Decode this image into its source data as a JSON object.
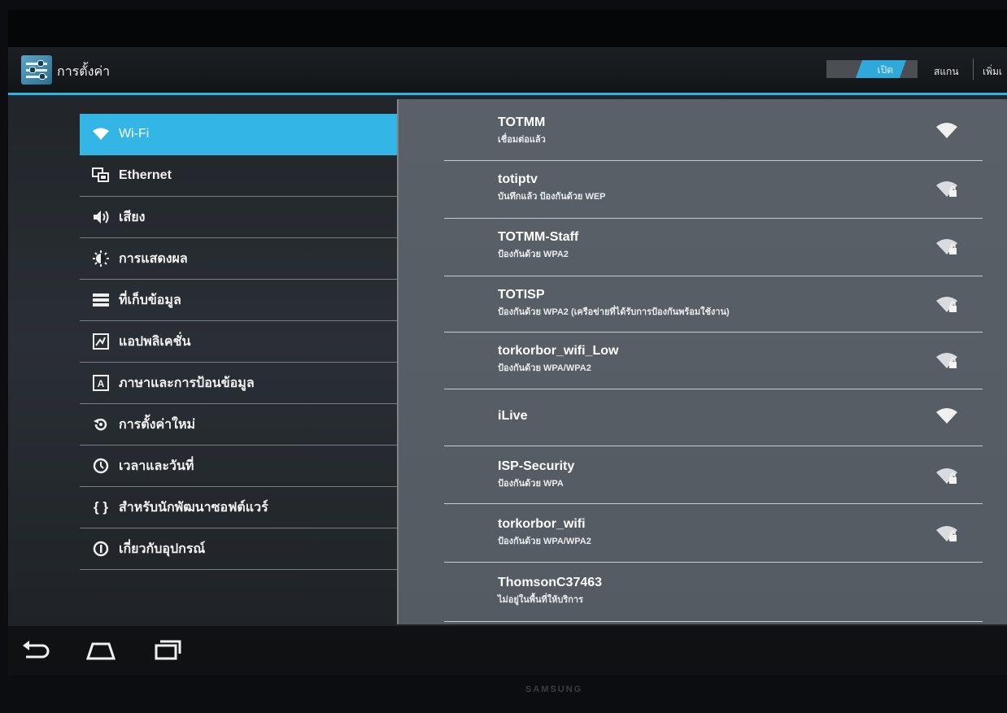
{
  "action_bar": {
    "title": "การตั้งค่า",
    "wifi_toggle": "เปิด",
    "scan": "สแกน",
    "add": "เพิ่มเ"
  },
  "sidebar": {
    "items": [
      {
        "label": "Wi-Fi",
        "icon": "wifi-icon",
        "active": true
      },
      {
        "label": "Ethernet",
        "icon": "ethernet-icon"
      },
      {
        "label": "เสียง",
        "icon": "speaker-icon"
      },
      {
        "label": "การแสดงผล",
        "icon": "display-icon"
      },
      {
        "label": "ที่เก็บข้อมูล",
        "icon": "storage-icon"
      },
      {
        "label": "แอปพลิเคชั่น",
        "icon": "apps-icon"
      },
      {
        "label": "ภาษาและการป้อนข้อมูล",
        "icon": "language-icon"
      },
      {
        "label": "การตั้งค่าใหม่",
        "icon": "reset-icon"
      },
      {
        "label": "เวลาและวันที่",
        "icon": "clock-icon"
      },
      {
        "label": "สำหรับนักพัฒนาซอฟต์แวร์",
        "icon": "developer-icon"
      },
      {
        "label": "เกี่ยวกับอุปกรณ์",
        "icon": "info-icon"
      }
    ]
  },
  "networks": [
    {
      "name": "TOTMM",
      "status": "เชื่อมต่อแล้ว",
      "secured": false,
      "signal": "wifi-signal-icon"
    },
    {
      "name": "totiptv",
      "status": "บันทึกแล้ว ป้องกันด้วย WEP",
      "secured": true,
      "signal": "wifi-lock-icon"
    },
    {
      "name": "TOTMM-Staff",
      "status": "ป้องกันด้วย WPA2",
      "secured": true,
      "signal": "wifi-lock-icon"
    },
    {
      "name": "TOTISP",
      "status": "ป้องกันด้วย WPA2 (เครือข่ายที่ได้รับการป้องกันพร้อมใช้งาน)",
      "secured": true,
      "signal": "wifi-lock-icon"
    },
    {
      "name": "torkorbor_wifi_Low",
      "status": "ป้องกันด้วย WPA/WPA2",
      "secured": true,
      "signal": "wifi-lock-icon"
    },
    {
      "name": "iLive",
      "status": "",
      "secured": false,
      "signal": "wifi-signal-icon"
    },
    {
      "name": "ISP-Security",
      "status": "ป้องกันด้วย WPA",
      "secured": true,
      "signal": "wifi-lock-icon"
    },
    {
      "name": "torkorbor_wifi",
      "status": "ป้องกันด้วย WPA/WPA2",
      "secured": true,
      "signal": "wifi-lock-icon"
    },
    {
      "name": "ThomsonC37463",
      "status": "ไม่อยู่ในพื้นที่ให้บริการ",
      "secured": true,
      "signal": ""
    }
  ],
  "navbar": {
    "buttons": [
      "back-icon",
      "home-icon",
      "recents-icon"
    ]
  },
  "bezel": {
    "brand": "SAMSUNG"
  },
  "colors": {
    "accent": "#33b5e5",
    "list_bg": "#5a6068",
    "screen_bg": "#2a2f35"
  }
}
